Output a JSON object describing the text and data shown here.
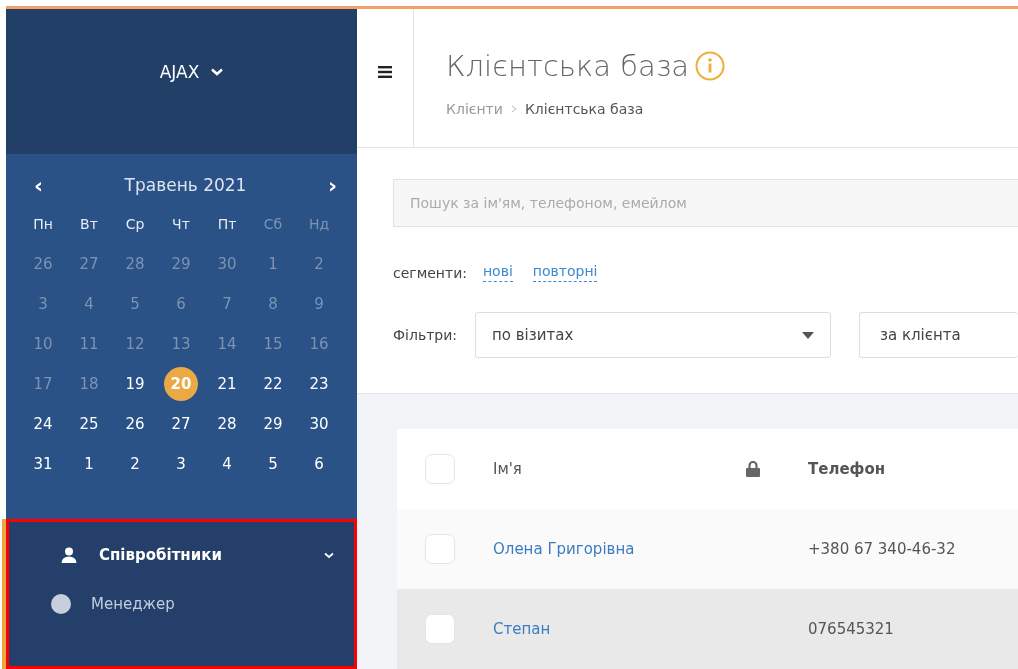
{
  "sidebar": {
    "company": "AJAX",
    "calendar": {
      "month": "Травень 2021",
      "prev": "‹",
      "next": "›",
      "weekdays": [
        {
          "label": "Пн",
          "muted": false
        },
        {
          "label": "Вт",
          "muted": false
        },
        {
          "label": "Ср",
          "muted": false
        },
        {
          "label": "Чт",
          "muted": false
        },
        {
          "label": "Пт",
          "muted": false
        },
        {
          "label": "Сб",
          "muted": true
        },
        {
          "label": "Нд",
          "muted": true
        }
      ],
      "weeks": [
        [
          {
            "day": "26",
            "muted": true,
            "selected": false
          },
          {
            "day": "27",
            "muted": true,
            "selected": false
          },
          {
            "day": "28",
            "muted": true,
            "selected": false
          },
          {
            "day": "29",
            "muted": true,
            "selected": false
          },
          {
            "day": "30",
            "muted": true,
            "selected": false
          },
          {
            "day": "1",
            "muted": true,
            "selected": false
          },
          {
            "day": "2",
            "muted": true,
            "selected": false
          }
        ],
        [
          {
            "day": "3",
            "muted": true,
            "selected": false
          },
          {
            "day": "4",
            "muted": true,
            "selected": false
          },
          {
            "day": "5",
            "muted": true,
            "selected": false
          },
          {
            "day": "6",
            "muted": true,
            "selected": false
          },
          {
            "day": "7",
            "muted": true,
            "selected": false
          },
          {
            "day": "8",
            "muted": true,
            "selected": false
          },
          {
            "day": "9",
            "muted": true,
            "selected": false
          }
        ],
        [
          {
            "day": "10",
            "muted": true,
            "selected": false
          },
          {
            "day": "11",
            "muted": true,
            "selected": false
          },
          {
            "day": "12",
            "muted": true,
            "selected": false
          },
          {
            "day": "13",
            "muted": true,
            "selected": false
          },
          {
            "day": "14",
            "muted": true,
            "selected": false
          },
          {
            "day": "15",
            "muted": true,
            "selected": false
          },
          {
            "day": "16",
            "muted": true,
            "selected": false
          }
        ],
        [
          {
            "day": "17",
            "muted": true,
            "selected": false
          },
          {
            "day": "18",
            "muted": true,
            "selected": false
          },
          {
            "day": "19",
            "muted": false,
            "selected": false
          },
          {
            "day": "20",
            "muted": false,
            "selected": true
          },
          {
            "day": "21",
            "muted": false,
            "selected": false
          },
          {
            "day": "22",
            "muted": false,
            "selected": false
          },
          {
            "day": "23",
            "muted": false,
            "selected": false
          }
        ],
        [
          {
            "day": "24",
            "muted": false,
            "selected": false
          },
          {
            "day": "25",
            "muted": false,
            "selected": false
          },
          {
            "day": "26",
            "muted": false,
            "selected": false
          },
          {
            "day": "27",
            "muted": false,
            "selected": false
          },
          {
            "day": "28",
            "muted": false,
            "selected": false
          },
          {
            "day": "29",
            "muted": false,
            "selected": false
          },
          {
            "day": "30",
            "muted": false,
            "selected": false
          }
        ],
        [
          {
            "day": "31",
            "muted": false,
            "selected": false
          },
          {
            "day": "1",
            "muted": false,
            "selected": false
          },
          {
            "day": "2",
            "muted": false,
            "selected": false
          },
          {
            "day": "3",
            "muted": false,
            "selected": false
          },
          {
            "day": "4",
            "muted": false,
            "selected": false
          },
          {
            "day": "5",
            "muted": false,
            "selected": false
          },
          {
            "day": "6",
            "muted": false,
            "selected": false
          }
        ]
      ]
    },
    "staff": {
      "title": "Співробітники",
      "expanded": true,
      "highlighted": true,
      "members": [
        "Менеджер"
      ]
    }
  },
  "header": {
    "title": "Клієнтська база",
    "breadcrumbs": [
      "Клієнти",
      "Клієнтська база"
    ]
  },
  "search": {
    "placeholder": "Пошук за ім'ям, телефоном, емейлом"
  },
  "segments": {
    "label": "сегменти:",
    "items": [
      "нові",
      "повторні"
    ]
  },
  "filters": {
    "label": "Фільтри:",
    "selects": [
      "по візитах",
      "за клієнта"
    ]
  },
  "table": {
    "columns": [
      "Ім'я",
      "Телефон"
    ],
    "all_checked": false,
    "rows": [
      {
        "name": "Олена Григорівна",
        "phone": "+380 67 340-46-32",
        "checked": false,
        "hover": false
      },
      {
        "name": "Степан",
        "phone": "076545321",
        "checked": false,
        "hover": true
      }
    ]
  }
}
